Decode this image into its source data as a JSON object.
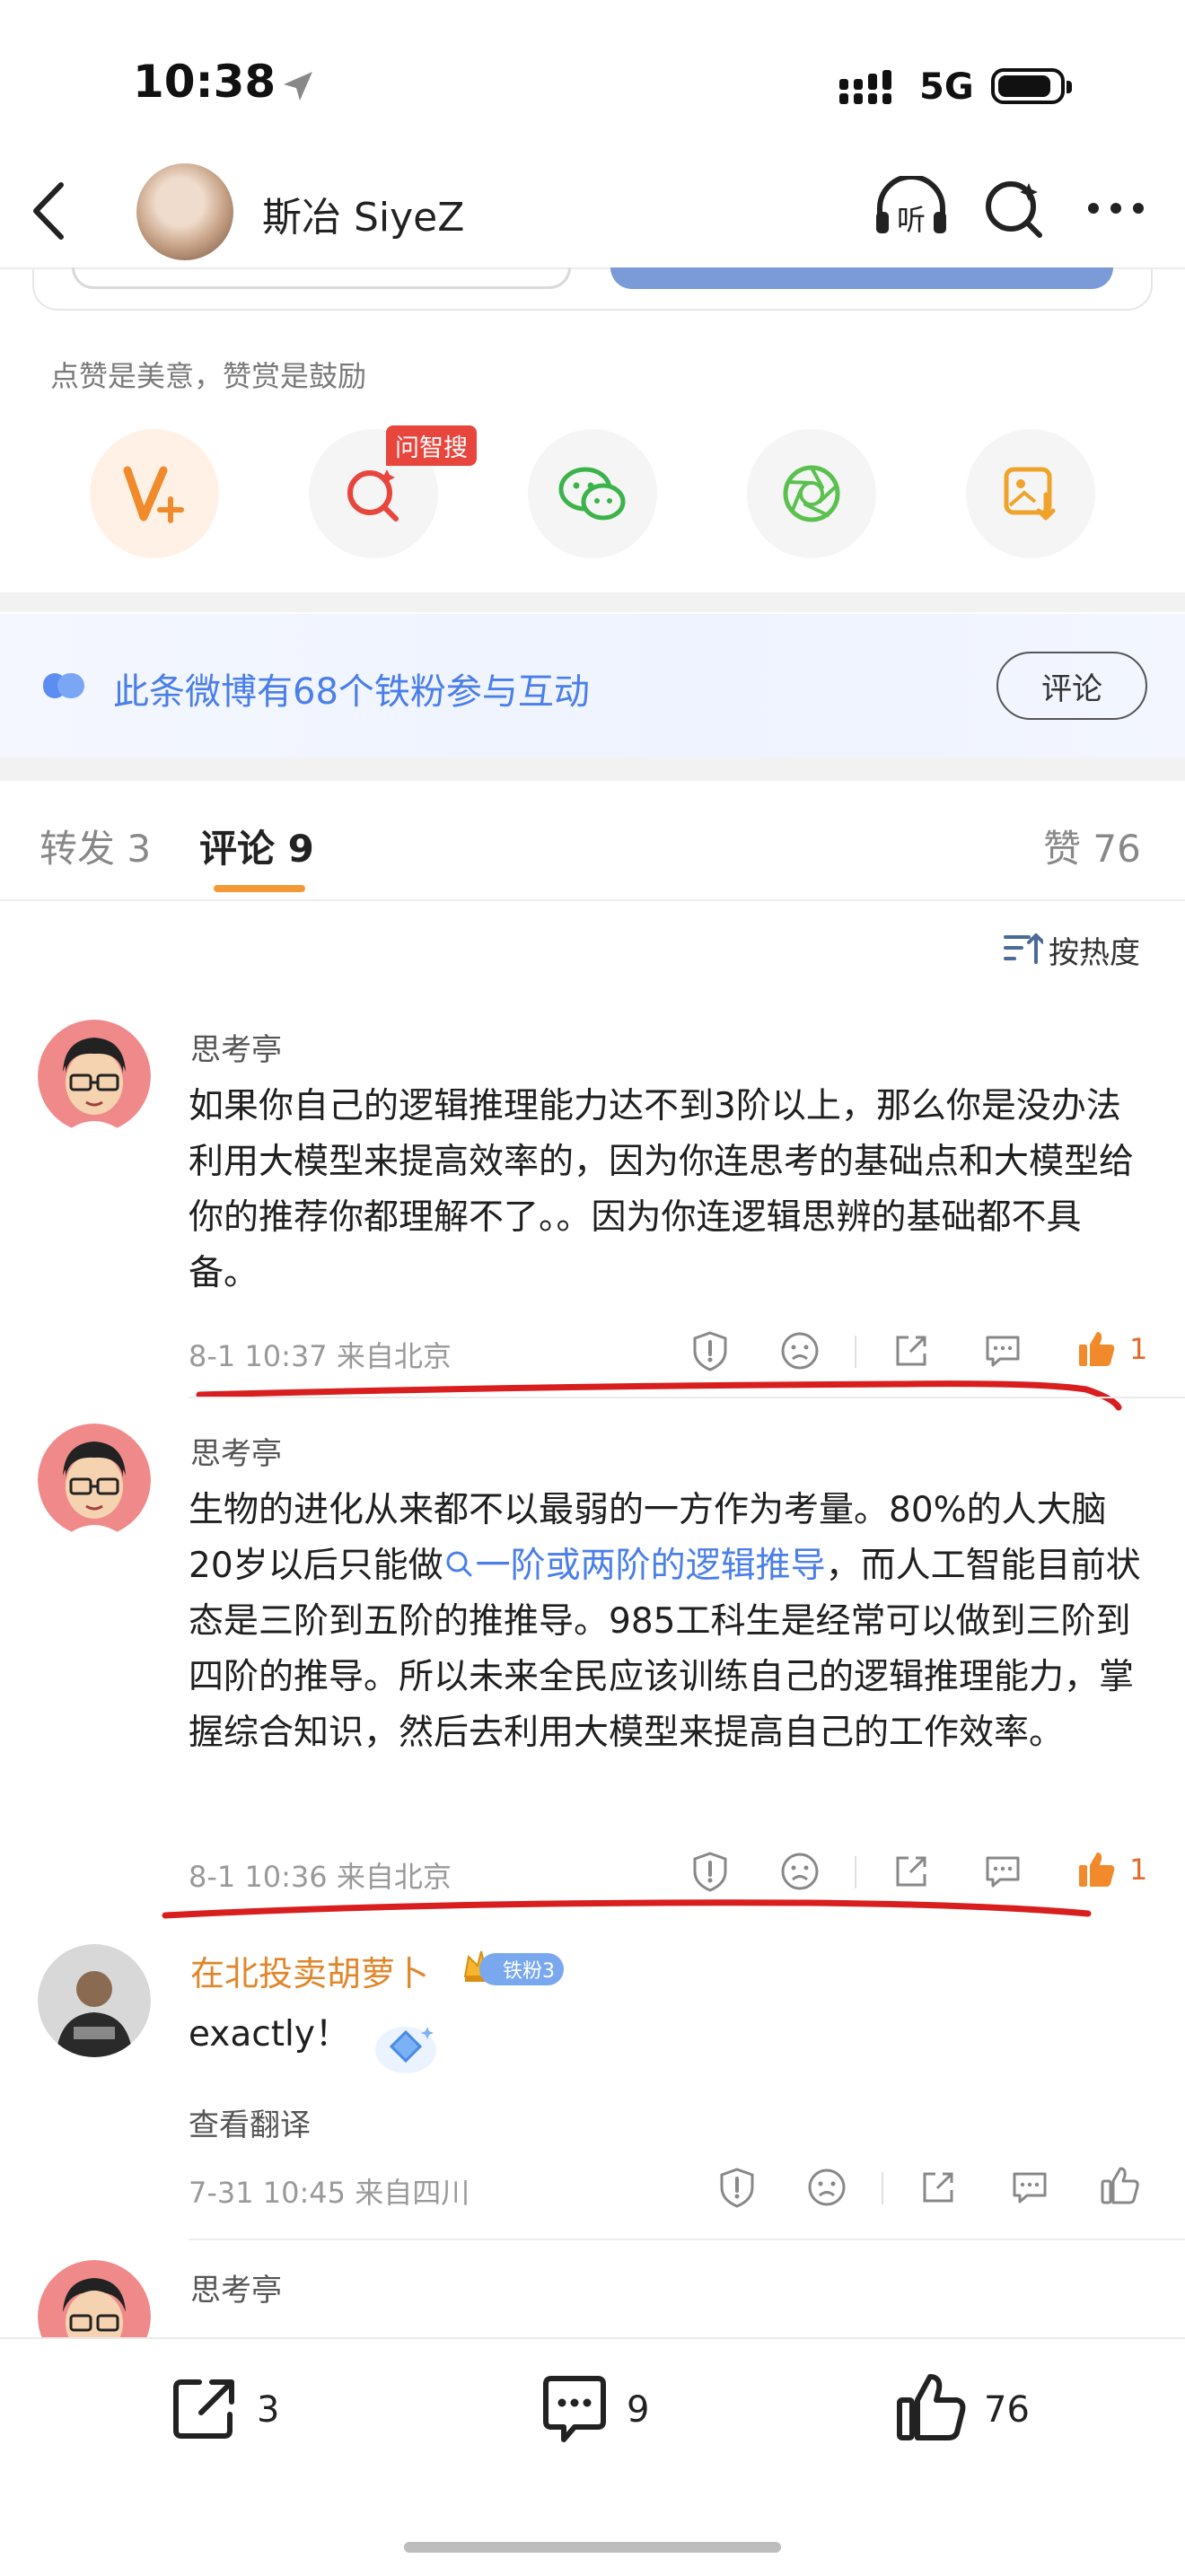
{
  "status_bar": {
    "time": "10:38",
    "network": "5G"
  },
  "header": {
    "user_name": "斯冶 SiyeZ",
    "listen_label": "听"
  },
  "like_hint": "点赞是美意，赞赏是鼓励",
  "share_row": {
    "zhisou_badge": "问智搜"
  },
  "fans_bar": {
    "text": "此条微博有68个铁粉参与互动",
    "button": "评论"
  },
  "tabs": {
    "repost": "转发 3",
    "comments": "评论 9",
    "likes": "赞 76"
  },
  "sort_label": "按热度",
  "comments": [
    {
      "user": "思考亭",
      "text": "如果你自己的逻辑推理能力达不到3阶以上，那么你是没办法利用大模型来提高效率的，因为你连思考的基础点和大模型给你的推荐你都理解不了。。因为你连逻辑思辨的基础都不具备。",
      "meta": "8-1 10:37 来自北京",
      "likes": "1"
    },
    {
      "user": "思考亭",
      "text_before": "生物的进化从来都不以最弱的一方作为考量。80%的人大脑20岁以后只能做",
      "text_link": "一阶或两阶的逻辑推导",
      "text_after": "，而人工智能目前状态是三阶到五阶的推推导。985工科生是经常可以做到三阶到四阶的推导。所以未来全民应该训练自己的逻辑推理能力，掌握综合知识，然后去利用大模型来提高自己的工作效率。",
      "meta": "8-1 10:36 来自北京",
      "likes": "1"
    },
    {
      "user": "在北投卖胡萝卜",
      "badge": "铁粉3",
      "text": "exactly！",
      "translate": "查看翻译",
      "meta": "7-31 10:45 来自四川"
    },
    {
      "user": "思考亭"
    }
  ],
  "bottom_bar": {
    "reposts": "3",
    "comments": "9",
    "likes": "76"
  },
  "colors": {
    "accent_blue": "#4a7ee8",
    "orange": "#e0862a",
    "like_orange": "#e06b2a",
    "red_underline": "#d81e1e"
  }
}
